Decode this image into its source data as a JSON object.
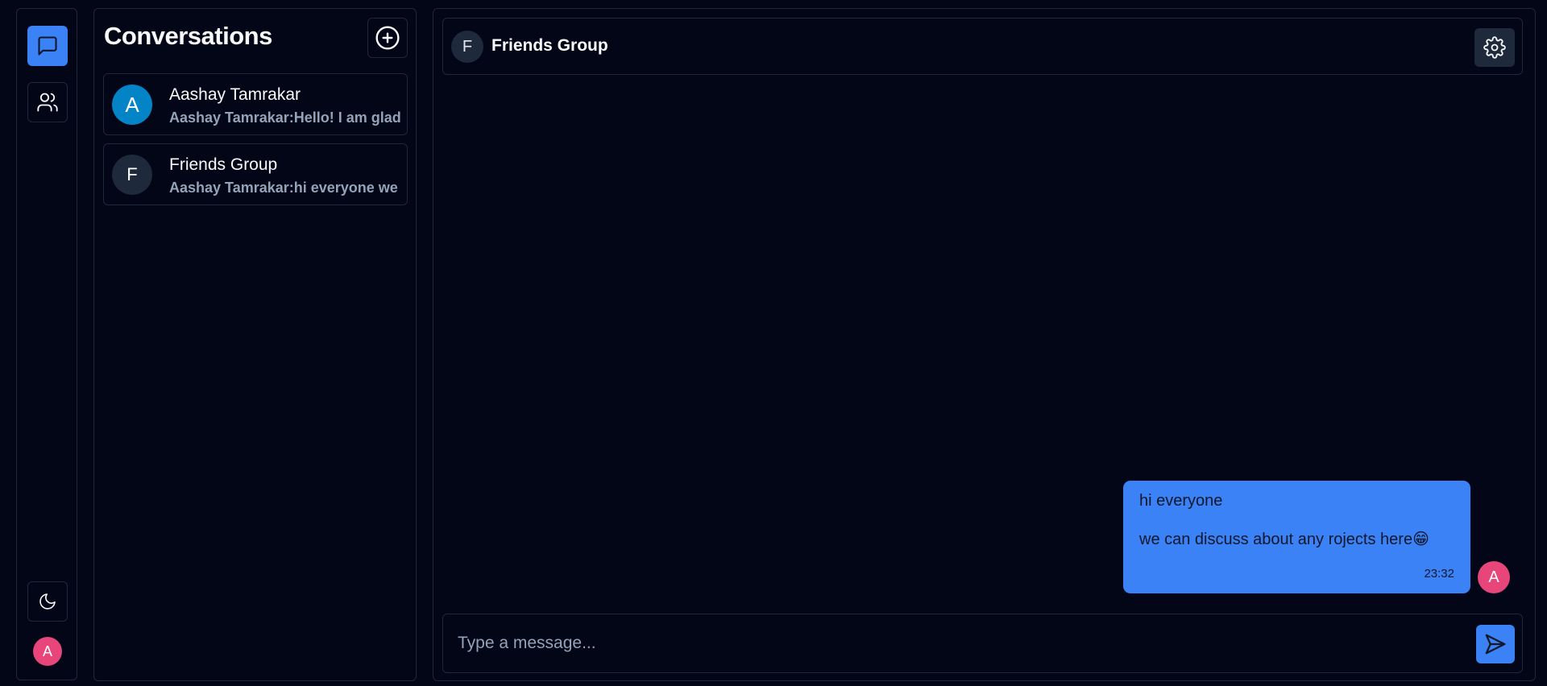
{
  "rail": {
    "icons": {
      "chats": "message-square-icon",
      "contacts": "users-icon",
      "theme": "moon-icon"
    },
    "user_initial": "A"
  },
  "conversations": {
    "title": "Conversations",
    "new_icon": "plus-circle-icon",
    "items": [
      {
        "initial": "A",
        "name": "Aashay Tamrakar",
        "preview": "Aashay Tamrakar:Hello! I am glad",
        "avatar_color": "#0284c7"
      },
      {
        "initial": "F",
        "name": "Friends Group",
        "preview": "Aashay Tamrakar:hi everyone we",
        "avatar_color": "#1e293b"
      }
    ]
  },
  "chat": {
    "header": {
      "initial": "F",
      "title": "Friends Group",
      "settings_icon": "gear-icon"
    },
    "messages": [
      {
        "line1": "hi everyone",
        "line2": "we can discuss about any rojects here😁",
        "time": "23:32",
        "author_initial": "A"
      }
    ],
    "composer": {
      "placeholder": "Type a message...",
      "value": "",
      "send_icon": "send-icon"
    }
  },
  "colors": {
    "background": "#020617",
    "border": "#1e293b",
    "accent": "#3b82f6",
    "user_avatar": "#e8457a",
    "muted_text": "#94a3b8"
  }
}
